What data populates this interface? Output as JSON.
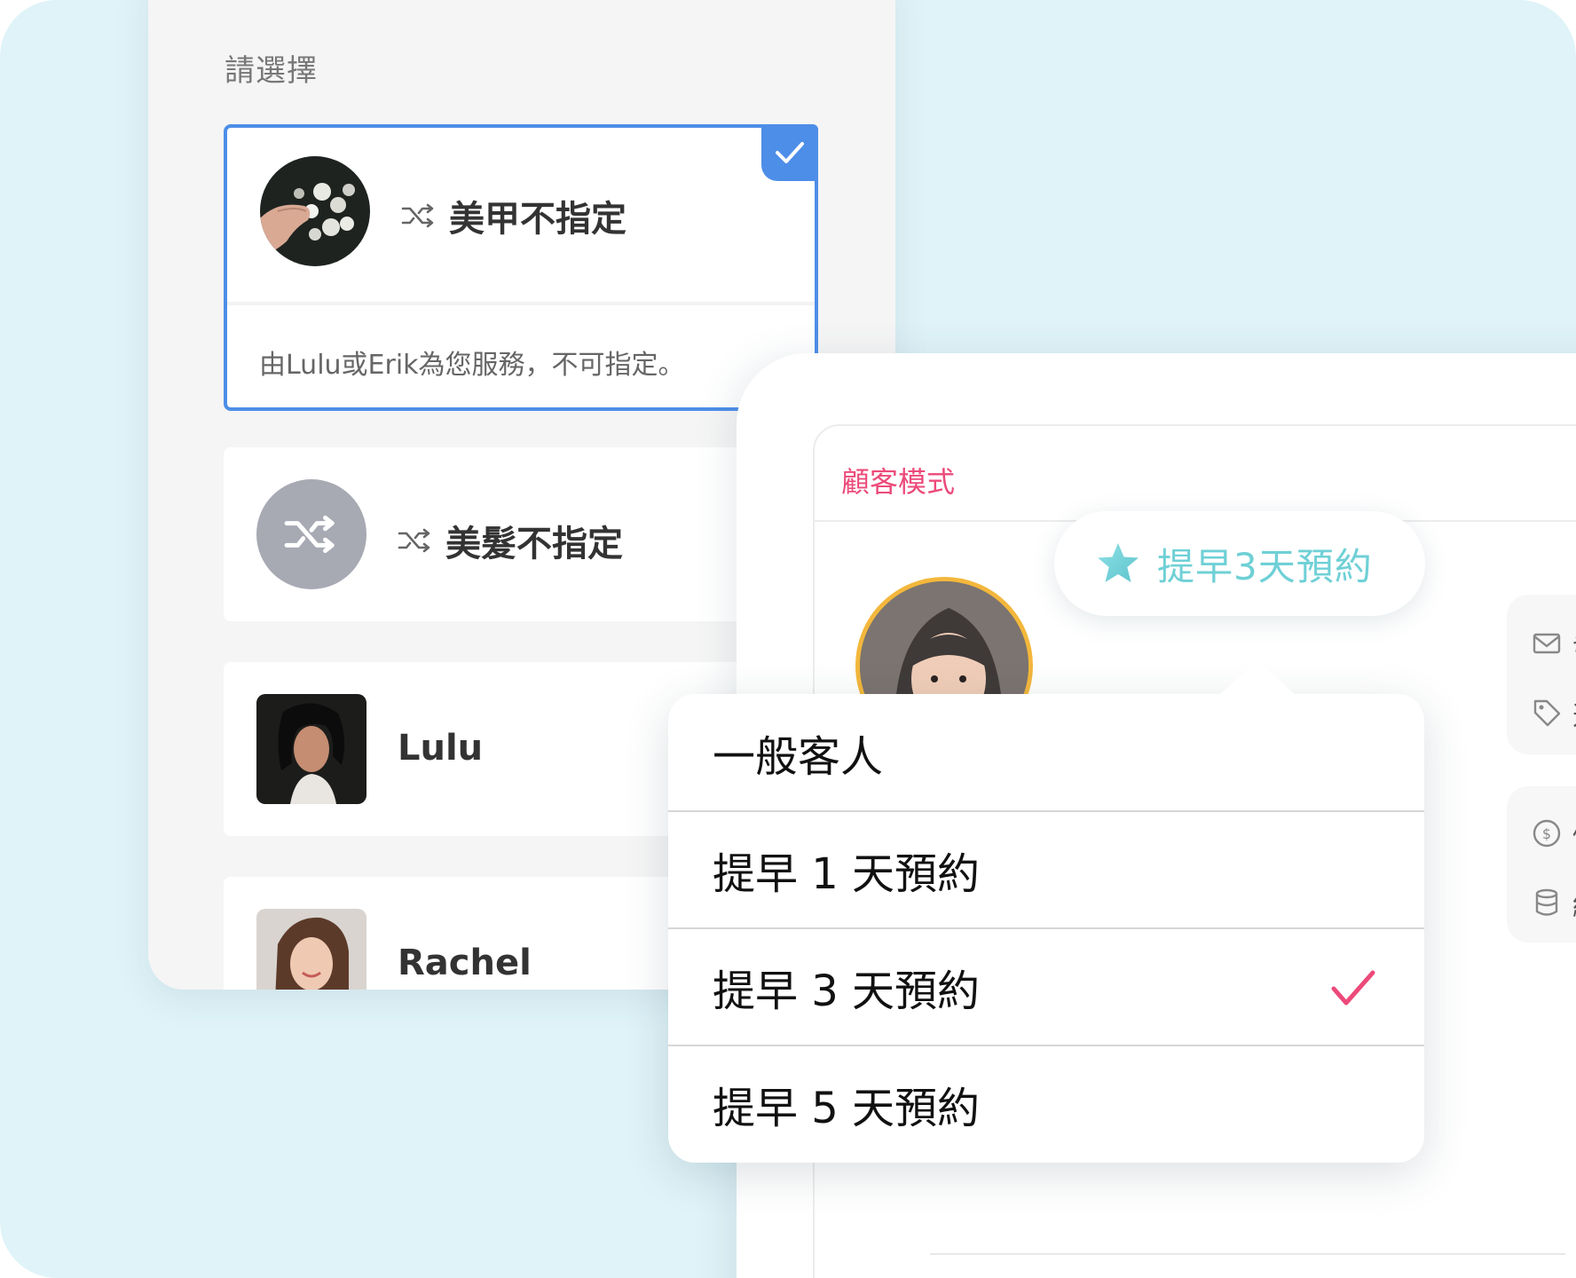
{
  "panel": {
    "title": "請選擇",
    "cards": [
      {
        "name": "美甲不指定",
        "desc": "由Lulu或Erik為您服務，不可指定。",
        "selected": true
      },
      {
        "name": "美髮不指定"
      },
      {
        "name": "Lulu"
      },
      {
        "name": "Rachel"
      }
    ]
  },
  "customer": {
    "mode_label": "顧客模式",
    "badge": "提早3天預約",
    "side_chars": [
      "發",
      "選",
      "儲",
      "結"
    ]
  },
  "dropdown": {
    "options": [
      "一般客人",
      "提早 1 天預約",
      "提早 3 天預約",
      "提早 5 天預約"
    ],
    "selected_index": 2
  },
  "colors": {
    "accent_blue": "#4d8ee8",
    "pink": "#ec4a7a",
    "teal": "#6fd0d6",
    "background": "#dff3f8"
  },
  "icons": [
    "shuffle-icon",
    "check-icon",
    "star-icon",
    "mail-icon",
    "tag-icon",
    "dollar-icon",
    "database-icon",
    "checkmark-icon"
  ]
}
